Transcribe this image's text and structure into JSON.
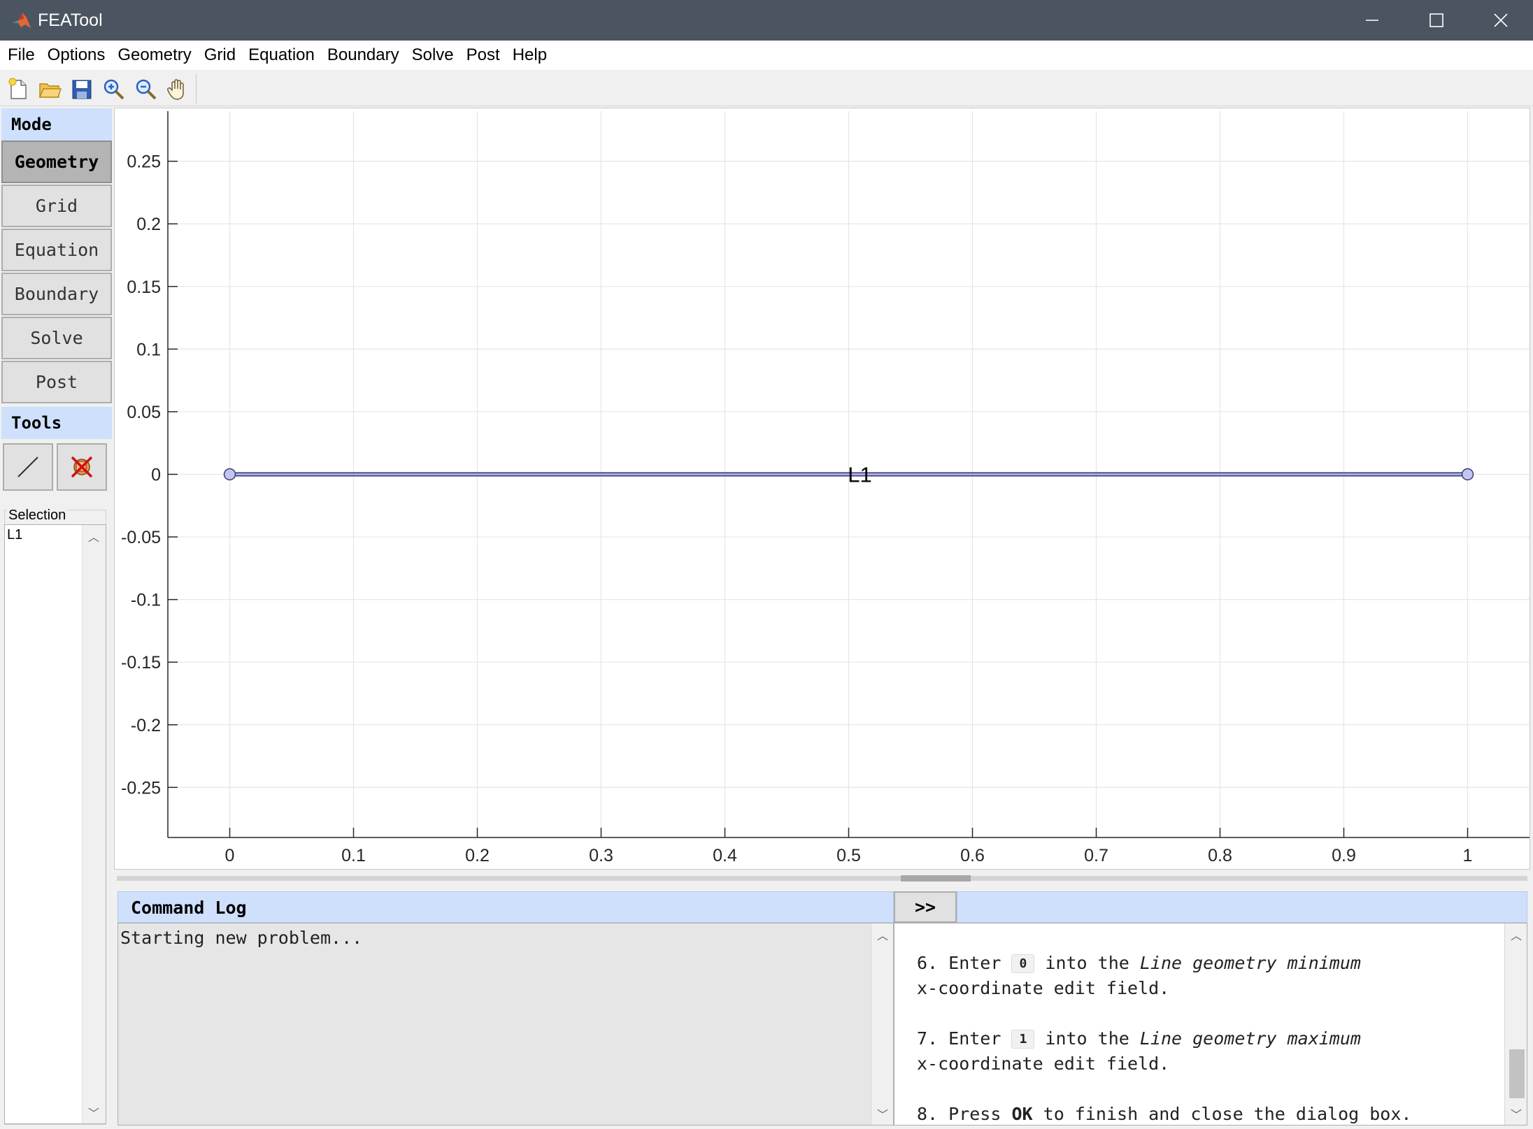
{
  "window": {
    "title": "FEATool"
  },
  "menu": [
    "File",
    "Options",
    "Geometry",
    "Grid",
    "Equation",
    "Boundary",
    "Solve",
    "Post",
    "Help"
  ],
  "toolbar": {
    "icons": [
      "new-file-icon",
      "open-folder-icon",
      "save-icon",
      "zoom-in-icon",
      "zoom-out-icon",
      "pan-hand-icon"
    ]
  },
  "mode": {
    "header": "Mode",
    "buttons": [
      "Geometry",
      "Grid",
      "Equation",
      "Boundary",
      "Solve",
      "Post"
    ],
    "active": "Geometry"
  },
  "tools": {
    "header": "Tools",
    "icons": [
      "line-draw-icon",
      "delete-geometry-icon"
    ]
  },
  "selection": {
    "label": "Selection",
    "items": [
      "L1"
    ]
  },
  "plot": {
    "geometry_label": "L1"
  },
  "chart_data": {
    "type": "line",
    "series": [
      {
        "x": [
          0,
          1
        ],
        "y": [
          0,
          0
        ]
      }
    ],
    "x_ticks": [
      "0",
      "0.1",
      "0.2",
      "0.3",
      "0.4",
      "0.5",
      "0.6",
      "0.7",
      "0.8",
      "0.9",
      "1"
    ],
    "y_ticks": [
      "0.25",
      "0.2",
      "0.15",
      "0.1",
      "0.05",
      "0",
      "-0.05",
      "-0.1",
      "-0.15",
      "-0.2",
      "-0.25"
    ],
    "xlim": [
      -0.05,
      1.05
    ],
    "ylim": [
      -0.29,
      0.29
    ],
    "grid": true,
    "title": "",
    "xlabel": "",
    "ylabel": "",
    "line_color": "#a8a8f0",
    "vertex_color": "#c4c4f4"
  },
  "command_log": {
    "header": "Command Log",
    "expand_label": ">>",
    "text": "Starting new problem..."
  },
  "help": {
    "step6": {
      "num": "6. Enter",
      "value": "0",
      "mid": "into the",
      "italic": "Line geometry minimum",
      "line2": "x-coordinate edit field."
    },
    "step7": {
      "num": "7. Enter",
      "value": "1",
      "mid": "into the",
      "italic": "Line geometry maximum",
      "line2": "x-coordinate edit field."
    },
    "step8": {
      "num": "8. Press",
      "bold": "OK",
      "rest": "to finish and close the dialog box."
    }
  },
  "colors": {
    "titlebar": "#4a5561",
    "header_blue": "#cfe0fc",
    "active_mode": "#b4b4b4"
  }
}
